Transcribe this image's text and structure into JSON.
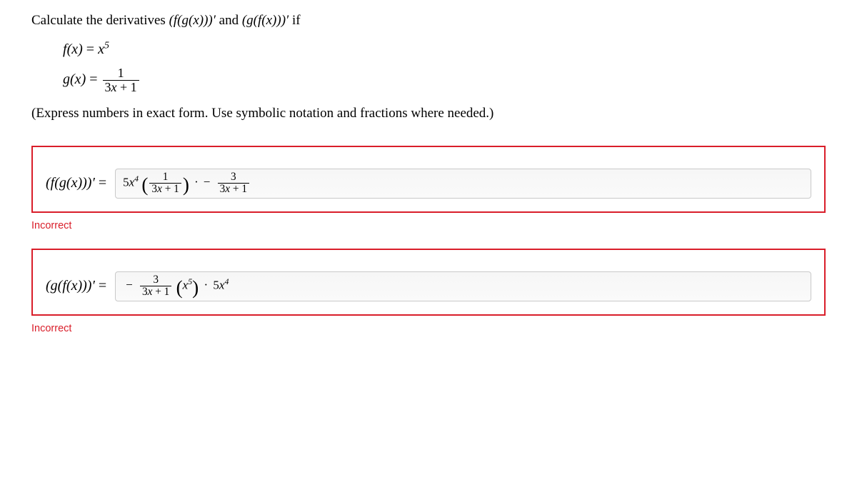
{
  "prompt": {
    "lead": "Calculate the derivatives ",
    "d1": "(f(g(x)))′",
    "and": " and ",
    "d2": "(g(f(x)))′",
    "tail": " if"
  },
  "functions": {
    "f_lhs": "f(x) = ",
    "f_rhs_base": "x",
    "f_rhs_exp": "5",
    "g_lhs": "g(x) = ",
    "g_frac_num": "1",
    "g_frac_den_a": "3",
    "g_frac_den_b": "x",
    "g_frac_den_c": " + 1"
  },
  "instruction": "(Express numbers in exact form. Use symbolic notation and fractions where needed.)",
  "answers": {
    "q1": {
      "label": "(f(g(x)))′ =",
      "value": {
        "coef": "5",
        "coef_var": "x",
        "coef_exp": "4",
        "frac1_num": "1",
        "frac1_den": "3x + 1",
        "op1": "· −",
        "frac2_num": "3",
        "frac2_den": "3x + 1"
      },
      "feedback": "Incorrect"
    },
    "q2": {
      "label": "(g(f(x)))′ =",
      "value": {
        "lead_minus": "−",
        "frac_num": "3",
        "frac_den": "3x + 1",
        "paren_var": "x",
        "paren_exp": "5",
        "dot": "·",
        "tail_coef": "5",
        "tail_var": "x",
        "tail_exp": "4"
      },
      "feedback": "Incorrect"
    }
  }
}
